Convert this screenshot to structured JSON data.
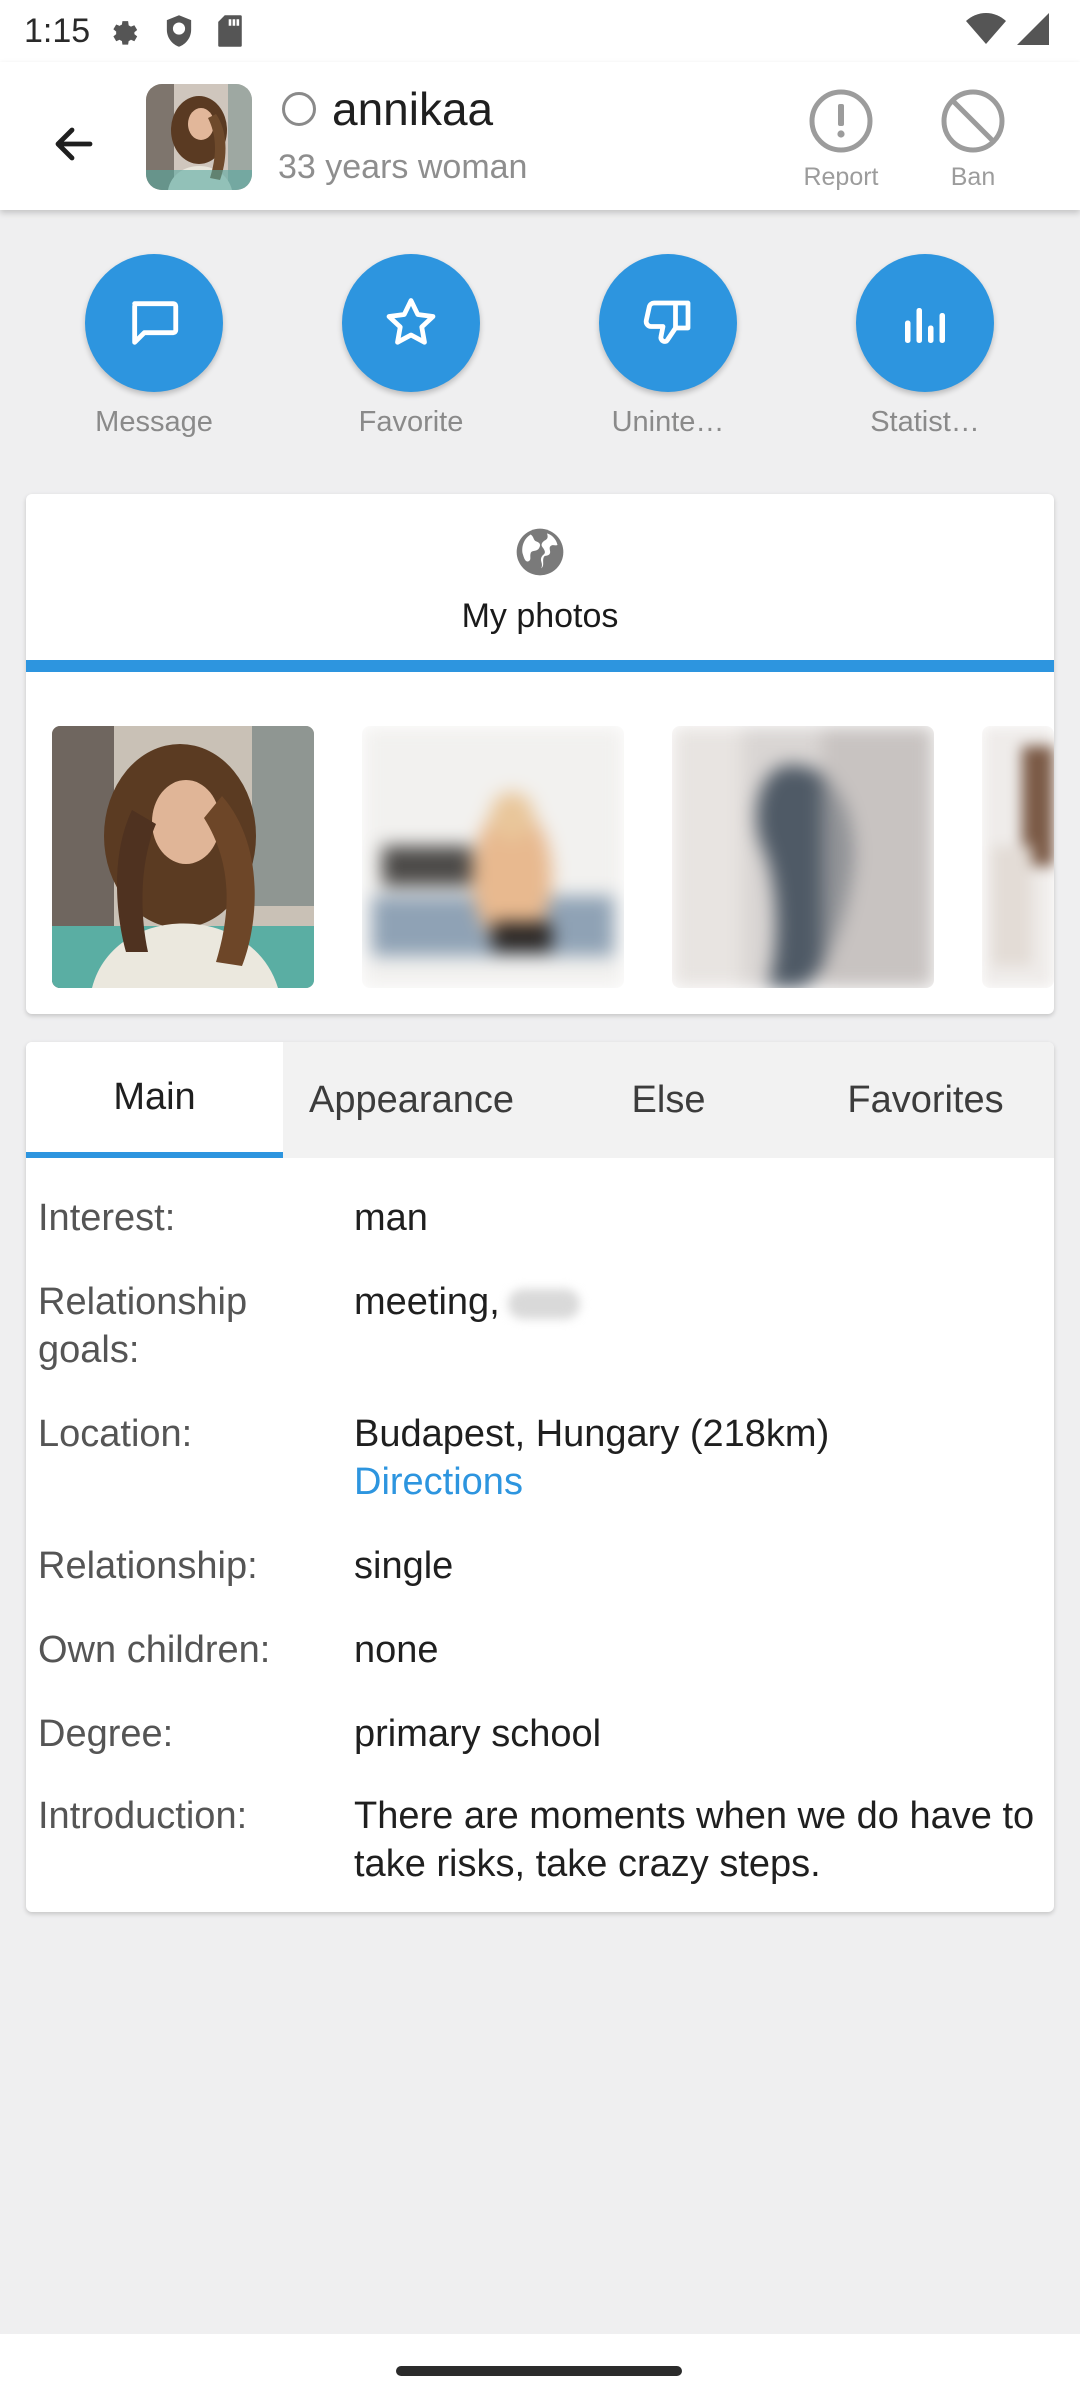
{
  "status_bar": {
    "time": "1:15",
    "icons": [
      "settings-icon",
      "shield-icon",
      "sd-card-icon",
      "wifi-icon",
      "signal-icon"
    ]
  },
  "header": {
    "back_icon": "arrow-back-icon",
    "username": "annikaa",
    "subtitle": "33 years woman",
    "online_status_icon": "offline-circle-icon",
    "report_label": "Report",
    "ban_label": "Ban"
  },
  "actions": [
    {
      "label": "Message",
      "icon": "chat-bubble-icon"
    },
    {
      "label": "Favorite",
      "icon": "star-icon"
    },
    {
      "label": "Uninte…",
      "icon": "thumb-down-icon"
    },
    {
      "label": "Statist…",
      "icon": "bar-chart-icon"
    }
  ],
  "photos": {
    "title": "My photos",
    "icon": "globe-icon",
    "items": [
      {
        "blurred": false
      },
      {
        "blurred": true
      },
      {
        "blurred": true
      },
      {
        "blurred": true
      }
    ]
  },
  "tabs": {
    "items": [
      "Main",
      "Appearance",
      "Else",
      "Favorites"
    ],
    "active": "Main"
  },
  "details": {
    "interest": {
      "label": "Interest:",
      "value": "man"
    },
    "relationship_goals": {
      "label": "Relationship goals:",
      "value": "meeting,"
    },
    "location": {
      "label": "Location:",
      "value": "Budapest, Hungary (218km)",
      "link": "Directions"
    },
    "relationship": {
      "label": "Relationship:",
      "value": "single"
    },
    "own_children": {
      "label": "Own children:",
      "value": "none"
    },
    "degree": {
      "label": "Degree:",
      "value": "primary school"
    },
    "introduction": {
      "label": "Introduction:",
      "value": "There are moments when we do have to take risks, take crazy steps."
    }
  },
  "colors": {
    "accent": "#2d95df",
    "background": "#efeff0"
  }
}
